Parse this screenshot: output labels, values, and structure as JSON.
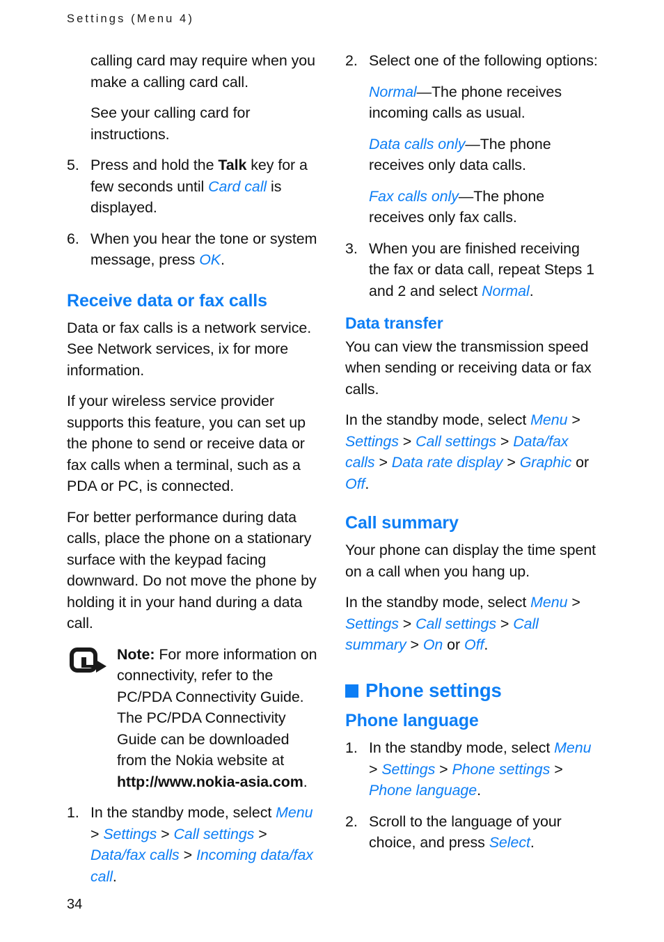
{
  "running_head": "Settings (Menu 4)",
  "page_number": "34",
  "colors": {
    "accent_blue": "#0d7ef5",
    "body_text": "#111111"
  },
  "left_column": {
    "continued_step4_text": "calling card may require when you make a calling card call.",
    "see_card_text": "See your calling card for instructions.",
    "step5": {
      "num": "5.",
      "part1": "Press and hold the ",
      "bold1": "Talk",
      "part2": " key for a few seconds until ",
      "ui1": "Card call",
      "part3": " is displayed."
    },
    "step6": {
      "num": "6.",
      "part1": "When you hear the tone or system message, press ",
      "ui1": "OK",
      "part2": "."
    },
    "heading_receive": "Receive data or fax calls",
    "para_network": "Data or fax calls is a network service. See Network services, ix for more information.",
    "para_provider": "If your wireless service provider supports this feature, you can set up the phone to send or receive data or fax calls when a terminal, such as a PDA or PC, is connected.",
    "para_performance": "For better performance during data calls, place the phone on a stationary surface with the keypad facing downward. Do not move the phone by holding it in your hand during a data call.",
    "note": {
      "icon_name": "note-arrow-icon",
      "label": "Note:",
      "body1": " For more information on connectivity, refer to the PC/PDA Connectivity Guide. The PC/PDA Connectivity Guide can be downloaded from the Nokia website at ",
      "url": "http://www.nokia-asia.com",
      "body2": "."
    },
    "step1": {
      "num": "1.",
      "part1": "In the standby mode, select ",
      "ui1": "Menu",
      "sep1": " > ",
      "ui2": "Settings",
      "sep2": " > ",
      "ui3": "Call settings",
      "sep3": " > ",
      "ui4": "Data/fax calls",
      "sep4": " > ",
      "ui5": "Incoming data/fax call",
      "part2": "."
    }
  },
  "right_column": {
    "step2": {
      "num": "2.",
      "text": "Select one of the following options:"
    },
    "option_normal": {
      "ui": "Normal",
      "text": "—The phone receives incoming calls as usual."
    },
    "option_data": {
      "ui": "Data calls only",
      "text": "—The phone receives only data calls."
    },
    "option_fax": {
      "ui": "Fax calls only",
      "text": "—The phone receives only fax calls."
    },
    "step3": {
      "num": "3.",
      "part1": "When you are finished receiving the fax or data call, repeat Steps 1 and 2 and select ",
      "ui1": "Normal",
      "part2": "."
    },
    "heading_data_transfer": "Data transfer",
    "para_transmission": "You can view the transmission speed when sending or receiving data or fax calls.",
    "path_data_rate": {
      "part1": "In the standby mode, select ",
      "ui1": "Menu",
      "sep1": " > ",
      "ui2": "Settings",
      "sep2": " > ",
      "ui3": "Call settings",
      "sep3": " > ",
      "ui4": "Data/fax calls",
      "sep4": " > ",
      "ui5": "Data rate display",
      "sep5": " > ",
      "ui6": "Graphic",
      "mid": " or ",
      "ui7": "Off",
      "end": "."
    },
    "heading_call_summary": "Call summary",
    "para_call_summary": "Your phone can display the time spent on a call when you hang up.",
    "path_call_summary": {
      "part1": "In the standby mode, select ",
      "ui1": "Menu",
      "sep1": " > ",
      "ui2": "Settings",
      "sep2": " > ",
      "ui3": "Call settings",
      "sep3": " > ",
      "ui4": "Call summary",
      "sep4": " > ",
      "ui5": "On",
      "mid": " or ",
      "ui6": "Off",
      "end": "."
    },
    "heading_phone_settings": "Phone settings",
    "heading_phone_language": "Phone language",
    "lang_step1": {
      "num": "1.",
      "part1": "In the standby mode, select ",
      "ui1": "Menu",
      "sep1": " > ",
      "ui2": "Settings",
      "sep2": " > ",
      "ui3": "Phone settings",
      "sep3": " > ",
      "ui4": "Phone language",
      "part2": "."
    },
    "lang_step2": {
      "num": "2.",
      "part1": "Scroll to the language of your choice, and press ",
      "ui1": "Select",
      "part2": "."
    }
  }
}
